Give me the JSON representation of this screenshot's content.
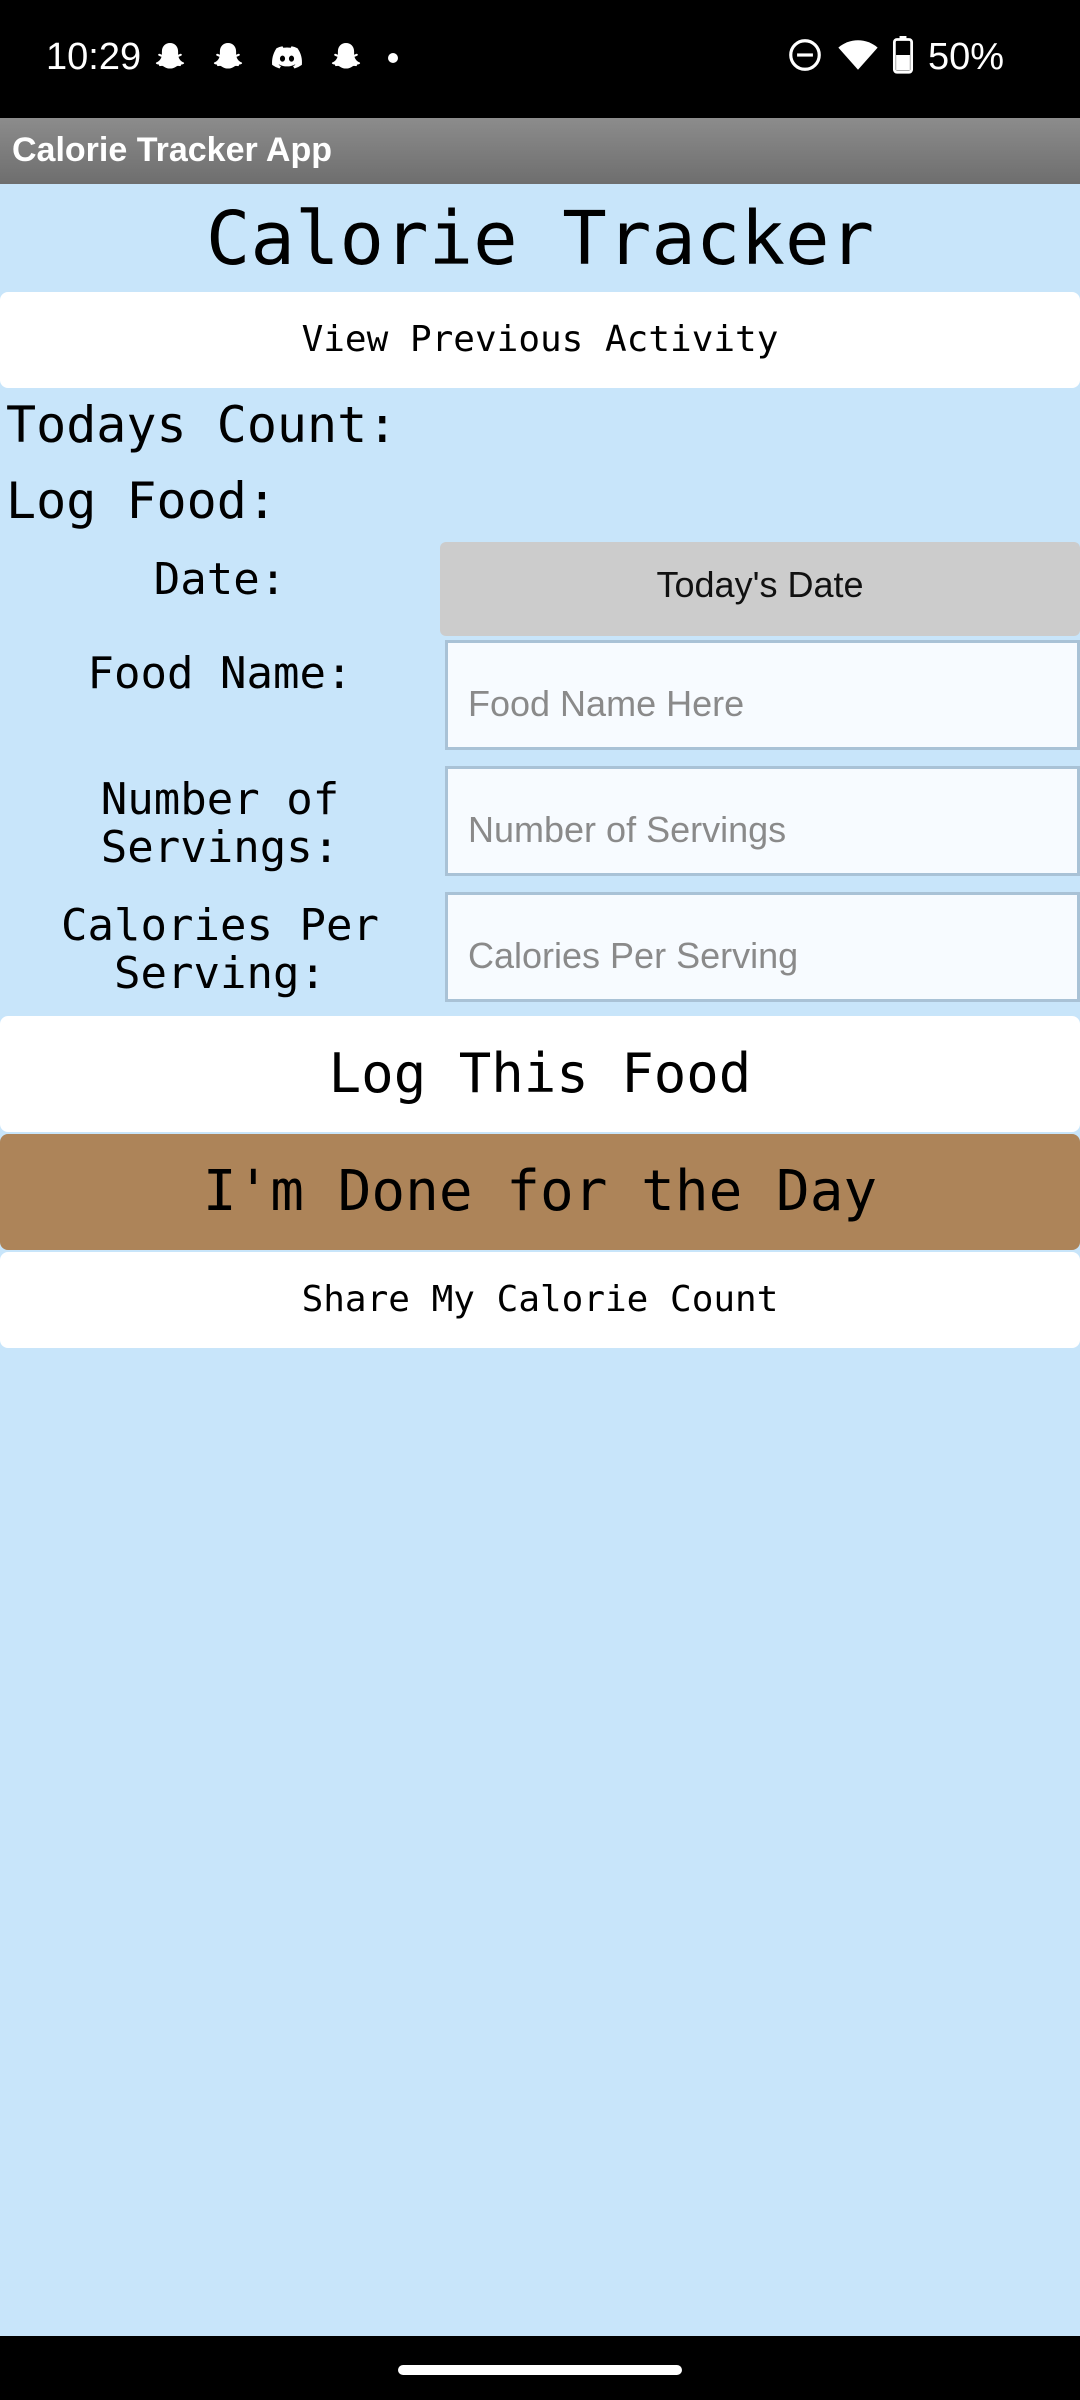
{
  "status_bar": {
    "time": "10:29",
    "battery": "50%",
    "notification_icons": [
      "snapchat-icon",
      "snapchat-icon",
      "discord-icon",
      "snapchat-icon",
      "more-dot-icon"
    ],
    "system_icons": [
      "do-not-disturb-icon",
      "wifi-icon",
      "battery-icon"
    ]
  },
  "app_bar": {
    "title": "Calorie Tracker App"
  },
  "main": {
    "title": "Calorie Tracker",
    "view_previous_label": "View Previous Activity",
    "todays_count_label": "Todays Count:",
    "log_food_label": "Log Food:",
    "date_label": "Date:",
    "date_button_label": "Today's Date",
    "food_name_label": "Food Name:",
    "food_name_placeholder": "Food Name Here",
    "servings_label": "Number of Servings:",
    "servings_placeholder": "Number of Servings",
    "calories_label": "Calories Per Serving:",
    "calories_placeholder": "Calories Per Serving",
    "log_button_label": "Log This Food",
    "done_button_label": "I'm Done for the Day",
    "share_button_label": "Share My Calorie Count"
  },
  "colors": {
    "background": "#c8e5fa",
    "done_button": "#ad8459",
    "date_button": "#cccccc",
    "app_bar": "#7d7d7d"
  }
}
